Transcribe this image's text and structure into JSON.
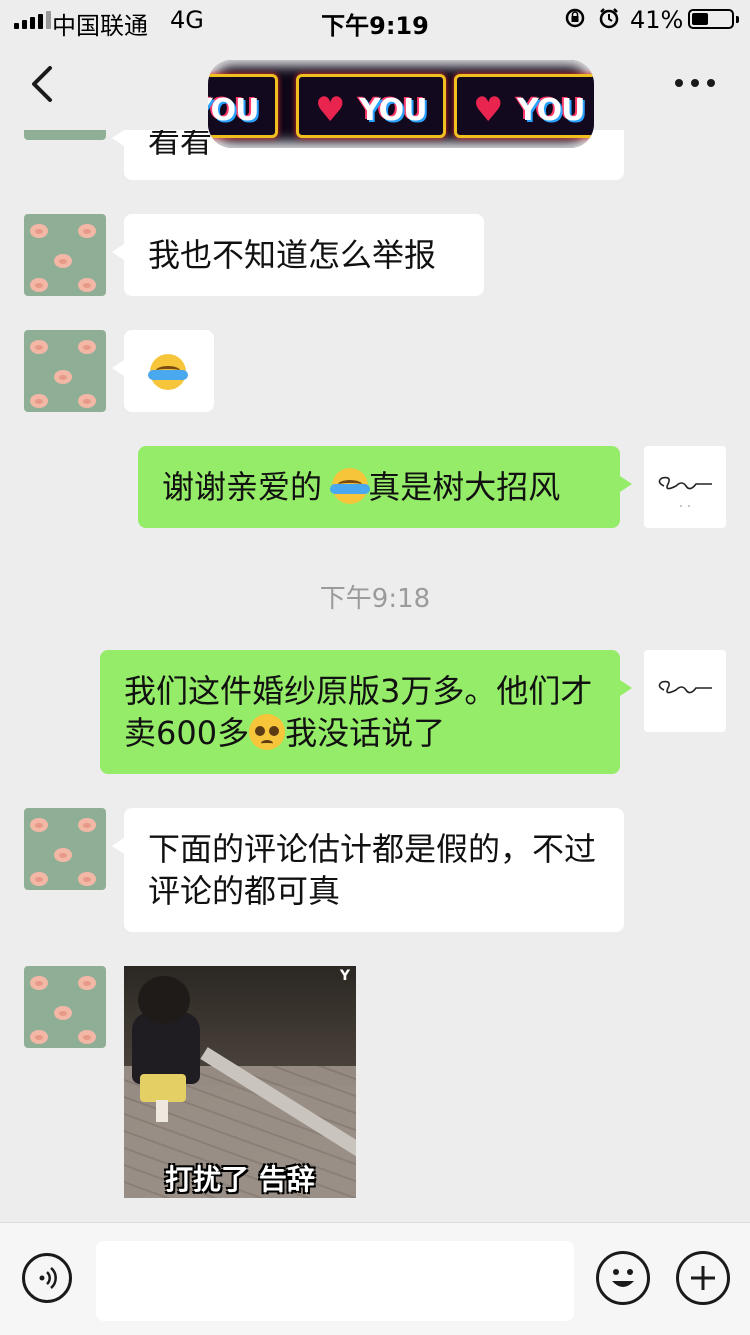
{
  "status_bar": {
    "carrier": "中国联通",
    "network": "4G",
    "time": "下午9:19",
    "battery": "41%"
  },
  "nav": {
    "banner_words": [
      "YOU",
      "YOU",
      "YOU"
    ]
  },
  "messages": {
    "m0": "看看",
    "m1": "我也不知道怎么举报",
    "m3_a": "谢谢亲爱的 ",
    "m3_b": "真是树大招风",
    "timestamp": "下午9:18",
    "m4_a": "我们这件婚纱原版3万多。他们才卖600多",
    "m4_b": "我没话说了",
    "m5": "下面的评论估计都是假的，不过评论的都可真",
    "gif_caption": "打扰了 告辞",
    "gif_watermark": "Y"
  },
  "input_bar": {
    "text": ""
  },
  "colors": {
    "out_bubble": "#95ec69",
    "in_bubble": "#ffffff",
    "background": "#ededed"
  }
}
